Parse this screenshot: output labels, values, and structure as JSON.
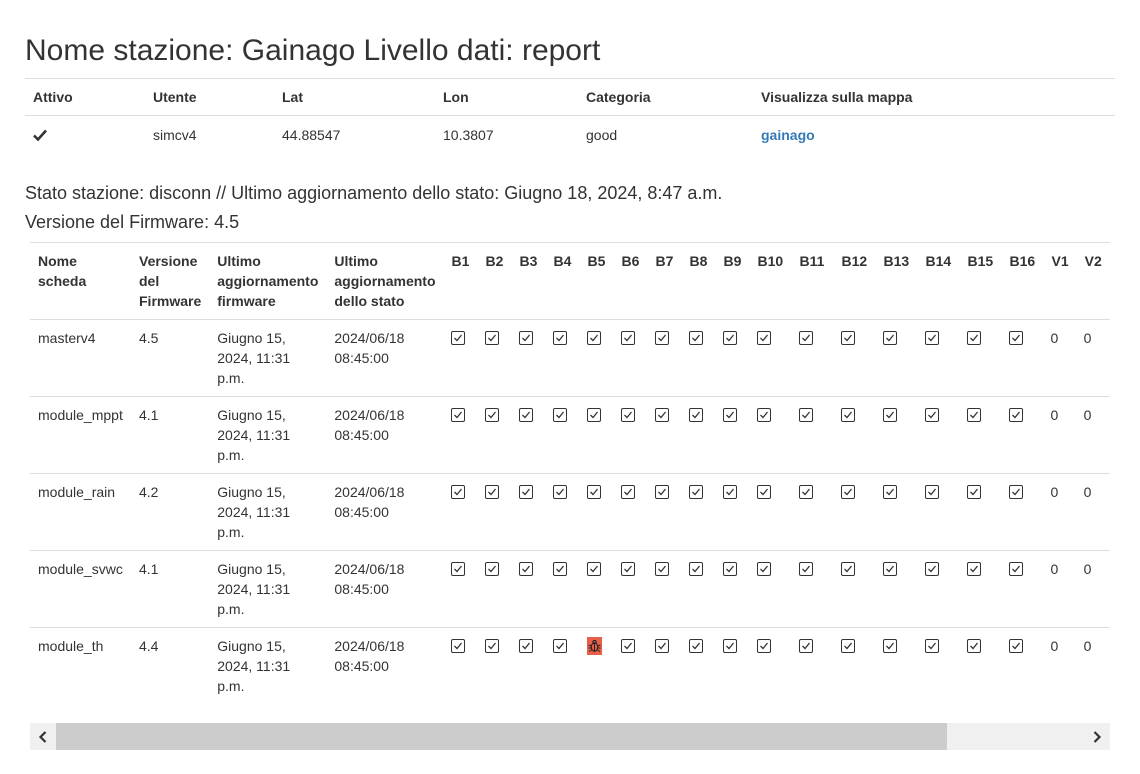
{
  "page": {
    "title": "Nome stazione: Gainago Livello dati: report"
  },
  "station_table": {
    "headers": [
      "Attivo",
      "Utente",
      "Lat",
      "Lon",
      "Categoria",
      "Visualizza sulla mappa"
    ],
    "row": {
      "active_icon": "check-icon",
      "user": "simcv4",
      "lat": "44.88547",
      "lon": "10.3807",
      "category": "good",
      "map_link": "gainago"
    }
  },
  "status": {
    "text": "Stato stazione: disconn // Ultimo aggiornamento dello stato: Giugno 18, 2024, 8:47 a.m."
  },
  "firmware": {
    "text": "Versione del Firmware: 4.5"
  },
  "boards_table": {
    "headers": {
      "name": [
        "Nome",
        "scheda"
      ],
      "version": [
        "Versione",
        "del",
        "Firmware"
      ],
      "fw_update": [
        "Ultimo",
        "aggiornamento",
        "firmware"
      ],
      "status_update": [
        "Ultimo",
        "aggiornamento",
        "dello stato"
      ],
      "bits": [
        "B1",
        "B2",
        "B3",
        "B4",
        "B5",
        "B6",
        "B7",
        "B8",
        "B9",
        "B10",
        "B11",
        "B12",
        "B13",
        "B14",
        "B15",
        "B16",
        "V1",
        "V2"
      ]
    },
    "rows": [
      {
        "name": "masterv4",
        "version": "4.5",
        "fw_update": [
          "Giugno 15,",
          "2024, 11:31",
          "p.m."
        ],
        "status_update": [
          "2024/06/18",
          "08:45:00"
        ],
        "bits": [
          "ok",
          "ok",
          "ok",
          "ok",
          "ok",
          "ok",
          "ok",
          "ok",
          "ok",
          "ok",
          "ok",
          "ok",
          "ok",
          "ok",
          "ok",
          "ok"
        ],
        "v1": "0",
        "v2": "0"
      },
      {
        "name": "module_mppt",
        "version": "4.1",
        "fw_update": [
          "Giugno 15,",
          "2024, 11:31",
          "p.m."
        ],
        "status_update": [
          "2024/06/18",
          "08:45:00"
        ],
        "bits": [
          "ok",
          "ok",
          "ok",
          "ok",
          "ok",
          "ok",
          "ok",
          "ok",
          "ok",
          "ok",
          "ok",
          "ok",
          "ok",
          "ok",
          "ok",
          "ok"
        ],
        "v1": "0",
        "v2": "0"
      },
      {
        "name": "module_rain",
        "version": "4.2",
        "fw_update": [
          "Giugno 15,",
          "2024, 11:31",
          "p.m."
        ],
        "status_update": [
          "2024/06/18",
          "08:45:00"
        ],
        "bits": [
          "ok",
          "ok",
          "ok",
          "ok",
          "ok",
          "ok",
          "ok",
          "ok",
          "ok",
          "ok",
          "ok",
          "ok",
          "ok",
          "ok",
          "ok",
          "ok"
        ],
        "v1": "0",
        "v2": "0"
      },
      {
        "name": "module_svwc",
        "version": "4.1",
        "fw_update": [
          "Giugno 15,",
          "2024, 11:31",
          "p.m."
        ],
        "status_update": [
          "2024/06/18",
          "08:45:00"
        ],
        "bits": [
          "ok",
          "ok",
          "ok",
          "ok",
          "ok",
          "ok",
          "ok",
          "ok",
          "ok",
          "ok",
          "ok",
          "ok",
          "ok",
          "ok",
          "ok",
          "ok"
        ],
        "v1": "0",
        "v2": "0"
      },
      {
        "name": "module_th",
        "version": "4.4",
        "fw_update": [
          "Giugno 15,",
          "2024, 11:31",
          "p.m."
        ],
        "status_update": [
          "2024/06/18",
          "08:45:00"
        ],
        "bits": [
          "ok",
          "ok",
          "ok",
          "ok",
          "error",
          "ok",
          "ok",
          "ok",
          "ok",
          "ok",
          "ok",
          "ok",
          "ok",
          "ok",
          "ok",
          "ok"
        ],
        "v1": "0",
        "v2": "0"
      }
    ]
  },
  "icons": {
    "ok": "checkbox-checked-icon",
    "error": "bug-icon",
    "scroll_left": "chevron-left-icon",
    "scroll_right": "chevron-right-icon"
  },
  "colors": {
    "error_bg": "#e8604a",
    "link": "#337ab7"
  }
}
